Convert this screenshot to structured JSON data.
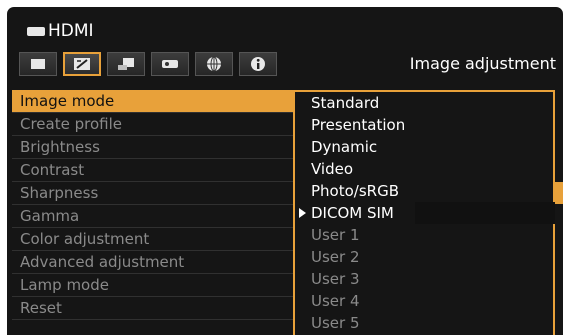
{
  "source": {
    "label": "HDMI",
    "icon": "hdmi-connector-icon"
  },
  "tabs": [
    {
      "name": "screen-settings",
      "icon": "screen-icon"
    },
    {
      "name": "image-adjustment",
      "icon": "image-adjust-icon",
      "active": true
    },
    {
      "name": "installation",
      "icon": "installation-icon"
    },
    {
      "name": "system-settings",
      "icon": "system-icon"
    },
    {
      "name": "network",
      "icon": "globe-icon"
    },
    {
      "name": "information",
      "icon": "info-icon"
    }
  ],
  "page_title": "Image adjustment",
  "menu": [
    {
      "label": "Image mode",
      "active": true
    },
    {
      "label": "Create profile"
    },
    {
      "label": "Brightness"
    },
    {
      "label": "Contrast"
    },
    {
      "label": "Sharpness"
    },
    {
      "label": "Gamma"
    },
    {
      "label": "Color adjustment"
    },
    {
      "label": "Advanced adjustment"
    },
    {
      "label": "Lamp mode"
    },
    {
      "label": "Reset"
    }
  ],
  "options": [
    {
      "label": "Standard"
    },
    {
      "label": "Presentation"
    },
    {
      "label": "Dynamic"
    },
    {
      "label": "Video"
    },
    {
      "label": "Photo/sRGB"
    },
    {
      "label": "DICOM SIM",
      "current": true
    },
    {
      "label": "User 1",
      "disabled": true
    },
    {
      "label": "User 2",
      "disabled": true
    },
    {
      "label": "User 3",
      "disabled": true
    },
    {
      "label": "User 4",
      "disabled": true
    },
    {
      "label": "User 5",
      "disabled": true
    }
  ],
  "colors": {
    "accent": "#e8a13a",
    "background": "#151515",
    "text": "#ffffff",
    "dim_text": "#8a8a8a"
  }
}
